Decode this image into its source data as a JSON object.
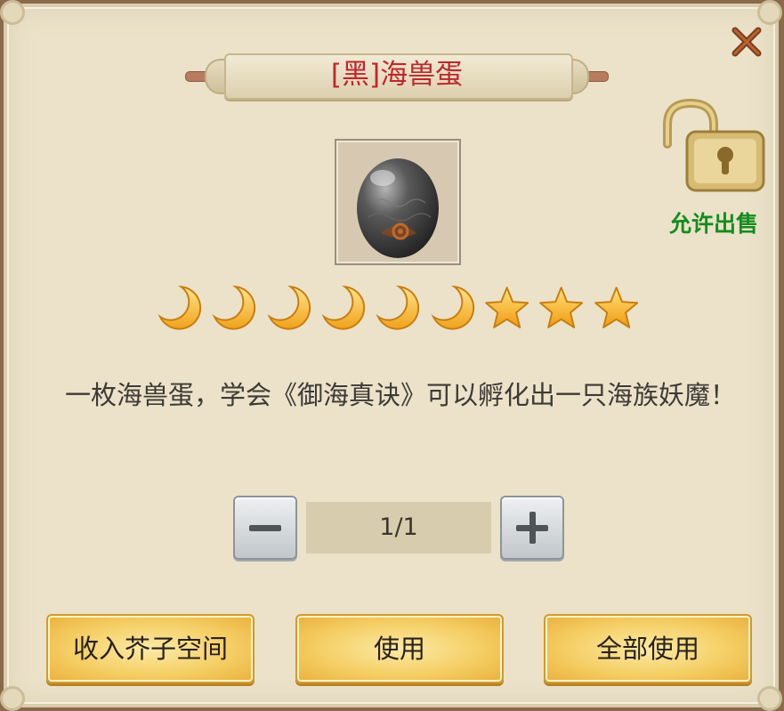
{
  "dialog": {
    "title": "[黑]海兽蛋",
    "close_icon": "close-x-icon",
    "item_icon": "black-sea-beast-egg-icon",
    "lock": {
      "icon": "open-padlock-icon",
      "label": "允许出售",
      "label_color": "#138c1e"
    },
    "rating": {
      "moons": 6,
      "stars": 3,
      "icons": [
        "crescent-moon-icon",
        "star-icon"
      ]
    },
    "description": "一枚海兽蛋，学会《御海真诀》可以孵化出一只海族妖魔！",
    "quantity": {
      "value": "1/1",
      "minus_icon": "minus-icon",
      "plus_icon": "plus-icon"
    },
    "buttons": {
      "store": "收入芥子空间",
      "use": "使用",
      "use_all": "全部使用"
    },
    "colors": {
      "title": "#c0262b",
      "panel_bg": "#ebe2c9",
      "button_gold": "#f5cf66"
    }
  }
}
